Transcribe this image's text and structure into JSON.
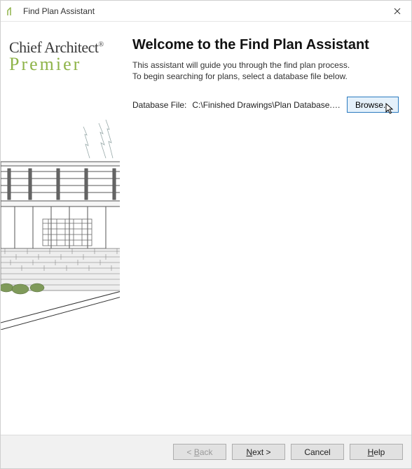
{
  "window": {
    "title": "Find Plan Assistant"
  },
  "brand": {
    "line1": "Chief Architect",
    "line2": "Premier"
  },
  "main": {
    "heading": "Welcome to the Find Plan Assistant",
    "intro1": "This assistant will guide you through the find plan process.",
    "intro2": "To begin searching for plans, select a database file below.",
    "db_label": "Database File:",
    "db_path": "C:\\Finished Drawings\\Plan Database.db",
    "browse_label": "Browse..."
  },
  "footer": {
    "back": "Back",
    "next": "Next >",
    "cancel": "Cancel",
    "help": "Help"
  }
}
